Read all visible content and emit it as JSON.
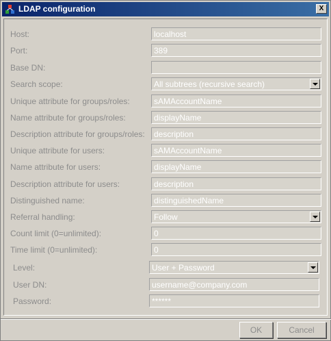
{
  "window": {
    "title": "LDAP configuration",
    "close_label": "X"
  },
  "form": {
    "fields": [
      {
        "label": "Host:",
        "value": "localhost",
        "type": "text"
      },
      {
        "label": "Port:",
        "value": "389",
        "type": "text"
      },
      {
        "label": "Base DN:",
        "value": "",
        "type": "text"
      },
      {
        "label": "Search scope:",
        "value": "All subtrees (recursive search)",
        "type": "select"
      },
      {
        "label": "Unique attribute for groups/roles:",
        "value": "sAMAccountName",
        "type": "text"
      },
      {
        "label": "Name attribute for groups/roles:",
        "value": "displayName",
        "type": "text"
      },
      {
        "label": "Description attribute for groups/roles:",
        "value": "description",
        "type": "text"
      },
      {
        "label": "Unique attribute for users:",
        "value": "sAMAccountName",
        "type": "text"
      },
      {
        "label": "Name attribute for users:",
        "value": "displayName",
        "type": "text"
      },
      {
        "label": "Description attribute for users:",
        "value": "description",
        "type": "text"
      },
      {
        "label": "Distinguished name:",
        "value": "distinguishedName",
        "type": "text"
      },
      {
        "label": "Referral handling:",
        "value": "Follow",
        "type": "select"
      },
      {
        "label": "Count limit (0=unlimited):",
        "value": "0",
        "type": "text"
      },
      {
        "label": "Time limit (0=unlimited):",
        "value": "0",
        "type": "text"
      }
    ],
    "auth": [
      {
        "label": "Level:",
        "value": "User + Password",
        "type": "select"
      },
      {
        "label": "User DN:",
        "value": "username@company.com",
        "type": "text"
      },
      {
        "label": "Password:",
        "value": "******",
        "type": "text"
      }
    ]
  },
  "buttons": {
    "ok": "OK",
    "cancel": "Cancel"
  }
}
